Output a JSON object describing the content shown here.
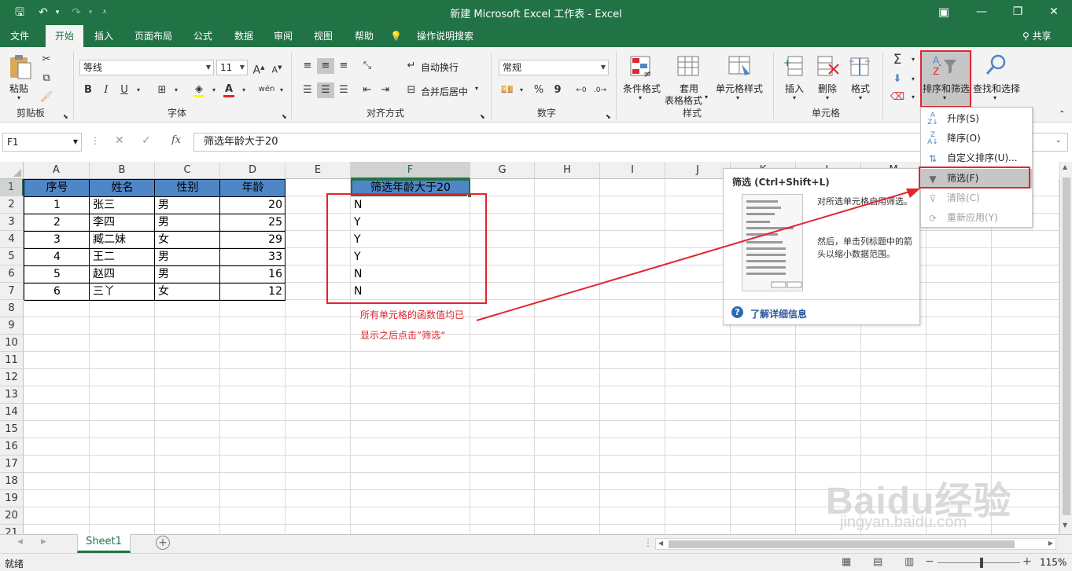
{
  "title": "新建 Microsoft Excel 工作表  -  Excel",
  "tabs": [
    "文件",
    "开始",
    "插入",
    "页面布局",
    "公式",
    "数据",
    "审阅",
    "视图",
    "帮助",
    "操作说明搜索",
    "共享"
  ],
  "ribbon": {
    "paste": "粘贴",
    "font_name": "等线",
    "font_size": "11",
    "bold": "B",
    "italic": "I",
    "underline": "U",
    "font_grow": "A",
    "font_shrink": "A",
    "wen": "wén",
    "wrap_text": "自动换行",
    "merge_center": "合并后居中",
    "number_format": "常规",
    "percent": "%",
    "comma": "9",
    "cond_format": "条件格式",
    "table_format_1": "套用",
    "table_format_2": "表格格式",
    "cell_styles": "单元格样式",
    "insert": "插入",
    "delete": "删除",
    "format": "格式",
    "sort_filter": "排序和筛选",
    "find_select": "查找和选择",
    "groups": {
      "clipboard": "剪贴板",
      "font": "字体",
      "alignment": "对齐方式",
      "number": "数字",
      "styles": "样式",
      "cells": "单元格"
    }
  },
  "formula_bar": {
    "name_box": "F1",
    "fx": "fx",
    "value": "筛选年龄大于20"
  },
  "columns": [
    "A",
    "B",
    "C",
    "D",
    "E",
    "F",
    "G",
    "H",
    "I",
    "J",
    "K",
    "L",
    "M"
  ],
  "rows": [
    "1",
    "2",
    "3",
    "4",
    "5",
    "6",
    "7",
    "8",
    "9",
    "10",
    "11",
    "12",
    "13",
    "14",
    "15",
    "16",
    "17",
    "18",
    "19",
    "20",
    "21"
  ],
  "table": {
    "headers": [
      "序号",
      "姓名",
      "性别",
      "年龄"
    ],
    "f_header": "筛选年龄大于20",
    "data": [
      [
        "1",
        "张三",
        "男",
        "20",
        "N"
      ],
      [
        "2",
        "李四",
        "男",
        "25",
        "Y"
      ],
      [
        "3",
        "臧二妹",
        "女",
        "29",
        "Y"
      ],
      [
        "4",
        "王二",
        "男",
        "33",
        "Y"
      ],
      [
        "5",
        "赵四",
        "男",
        "16",
        "N"
      ],
      [
        "6",
        "三丫",
        "女",
        "12",
        "N"
      ]
    ]
  },
  "annotation": {
    "line1": "所有单元格的函数值均已",
    "line2": "显示之后点击”筛选“"
  },
  "sort_menu": {
    "asc": "升序(S)",
    "desc": "降序(O)",
    "custom": "自定义排序(U)...",
    "filter": "筛选(F)",
    "clear": "清除(C)",
    "reapply": "重新应用(Y)"
  },
  "tooltip": {
    "title": "筛选 (Ctrl+Shift+L)",
    "p1": "对所选单元格启用筛选。",
    "p2": "然后，单击列标题中的箭头以缩小数据范围。",
    "more": "了解详细信息"
  },
  "sheet_tab": "Sheet1",
  "status": {
    "ready": "就绪",
    "zoom": "115%"
  },
  "watermark": {
    "logo": "Baidu经验",
    "url": "jingyan.baidu.com"
  },
  "colors": {
    "excel_green": "#217346",
    "header_fill": "#4f86c6",
    "highlight_red": "#e0262f"
  }
}
